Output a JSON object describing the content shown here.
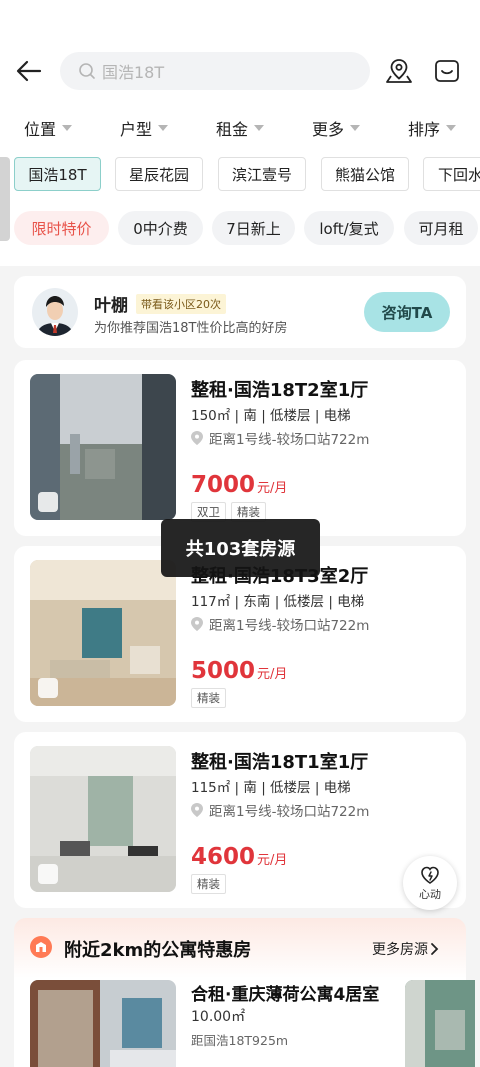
{
  "search": {
    "placeholder": "国浩18T"
  },
  "filters": [
    "位置",
    "户型",
    "租金",
    "更多",
    "排序"
  ],
  "communities": [
    "国浩18T",
    "星辰花园",
    "滨江壹号",
    "熊猫公馆",
    "下回水"
  ],
  "tags": [
    "限时特价",
    "0中介费",
    "7日新上",
    "loft/复式",
    "可月租"
  ],
  "agent": {
    "name": "叶棚",
    "badge": "带看该小区20次",
    "desc": "为你推荐国浩18T性价比高的好房",
    "button": "咨询TA"
  },
  "listings": [
    {
      "title": "整租·国浩18T2室1厅",
      "meta": "150㎡ | 南 | 低楼层 | 电梯",
      "distance": "距离1号线-较场口站722m",
      "price": "7000",
      "unit": "元/月",
      "labels": [
        "双卫",
        "精装"
      ]
    },
    {
      "title": "整租·国浩18T3室2厅",
      "meta": "117㎡ | 东南 | 低楼层 | 电梯",
      "distance": "距离1号线-较场口站722m",
      "price": "5000",
      "unit": "元/月",
      "labels": [
        "精装"
      ]
    },
    {
      "title": "整租·国浩18T1室1厅",
      "meta": "115㎡ | 南 | 低楼层 | 电梯",
      "distance": "距离1号线-较场口站722m",
      "price": "4600",
      "unit": "元/月",
      "labels": [
        "精装"
      ]
    }
  ],
  "toast": "共103套房源",
  "float_button": "心动",
  "nearby": {
    "title": "附近2km的公寓特惠房",
    "more": "更多房源",
    "item": {
      "title": "合租·重庆薄荷公寓4居室",
      "area": "10.00㎡",
      "distance": "距国浩18T925m"
    }
  }
}
